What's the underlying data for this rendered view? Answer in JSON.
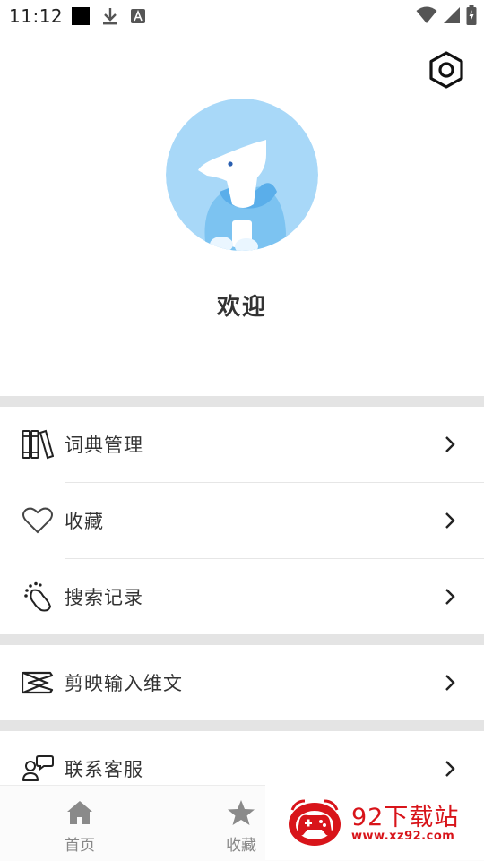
{
  "status_bar": {
    "time": "11:12"
  },
  "profile": {
    "welcome": "欢迎"
  },
  "menu": {
    "group1": [
      {
        "label": "词典管理",
        "icon": "books-icon"
      },
      {
        "label": "收藏",
        "icon": "heart-icon"
      },
      {
        "label": "搜索记录",
        "icon": "footprints-icon"
      }
    ],
    "group2": [
      {
        "label": "剪映输入维文",
        "icon": "capcut-icon"
      }
    ],
    "group3": [
      {
        "label": "联系客服",
        "icon": "customer-service-icon"
      }
    ]
  },
  "bottom_nav": {
    "tabs": [
      {
        "label": "首页",
        "icon": "home-icon"
      },
      {
        "label": "收藏",
        "icon": "star-icon"
      }
    ]
  },
  "watermark": {
    "title": "92下载站",
    "url": "www.xz92.com"
  },
  "colors": {
    "avatar_bg": "#a8d8f8",
    "divider": "#e4e4e4",
    "watermark_red": "#d8141a",
    "nav_icon": "#8a8a8a"
  }
}
